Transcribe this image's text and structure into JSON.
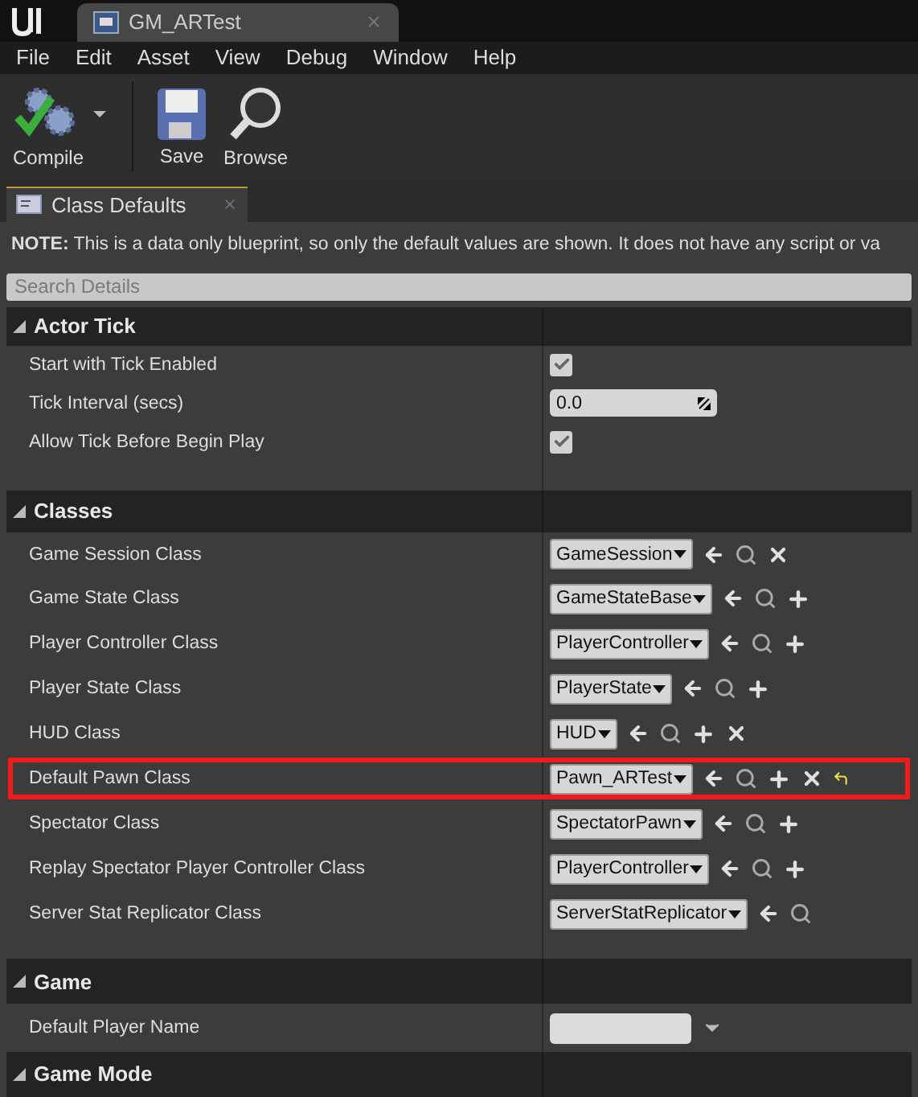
{
  "window": {
    "tab": "GM_ARTest"
  },
  "menu": [
    "File",
    "Edit",
    "Asset",
    "View",
    "Debug",
    "Window",
    "Help"
  ],
  "toolbar": [
    {
      "kind": "compile",
      "label": "Compile",
      "has_dropdown": true
    },
    {
      "kind": "save",
      "label": "Save",
      "has_dropdown": false
    },
    {
      "kind": "browse",
      "label": "Browse",
      "has_dropdown": false
    }
  ],
  "panel_tab": {
    "label": "Class Defaults"
  },
  "note": "**NOTE:** This is a data only blueprint, so only the default values are shown.  It does not have any script or va",
  "search": {
    "placeholder": "Search Details"
  },
  "sections": [
    {
      "title": "Actor Tick",
      "expanded": true,
      "rows": [
        {
          "label": "Start with Tick Enabled",
          "kind": "checkbox",
          "checked": true
        },
        {
          "label": "Tick Interval (secs)",
          "kind": "number",
          "value": "0.0"
        },
        {
          "label": "Allow Tick Before Begin Play",
          "kind": "checkbox",
          "checked": true
        }
      ]
    },
    {
      "title": "Classes",
      "expanded": true,
      "rows": [
        {
          "label": "Game Session Class",
          "kind": "class",
          "value": "GameSession",
          "buttons": [
            {
              "kind": "use"
            },
            {
              "kind": "browse"
            },
            {
              "kind": "clear"
            }
          ],
          "highlighted": false
        },
        {
          "label": "Game State Class",
          "kind": "class",
          "value": "GameStateBase",
          "buttons": [
            {
              "kind": "use"
            },
            {
              "kind": "browse"
            },
            {
              "kind": "add"
            }
          ],
          "highlighted": false
        },
        {
          "label": "Player Controller Class",
          "kind": "class",
          "value": "PlayerController",
          "buttons": [
            {
              "kind": "use"
            },
            {
              "kind": "browse"
            },
            {
              "kind": "add"
            }
          ],
          "highlighted": false
        },
        {
          "label": "Player State Class",
          "kind": "class",
          "value": "PlayerState",
          "buttons": [
            {
              "kind": "use"
            },
            {
              "kind": "browse"
            },
            {
              "kind": "add"
            }
          ],
          "highlighted": false
        },
        {
          "label": "HUD Class",
          "kind": "class",
          "value": "HUD",
          "buttons": [
            {
              "kind": "use"
            },
            {
              "kind": "browse"
            },
            {
              "kind": "add"
            },
            {
              "kind": "clear"
            }
          ],
          "highlighted": false
        },
        {
          "label": "Default Pawn Class",
          "kind": "class",
          "value": "Pawn_ARTest",
          "buttons": [
            {
              "kind": "use"
            },
            {
              "kind": "browse"
            },
            {
              "kind": "add"
            },
            {
              "kind": "clear"
            },
            {
              "kind": "reset"
            }
          ],
          "highlighted": true
        },
        {
          "label": "Spectator Class",
          "kind": "class",
          "value": "SpectatorPawn",
          "buttons": [
            {
              "kind": "use"
            },
            {
              "kind": "browse"
            },
            {
              "kind": "add"
            }
          ],
          "highlighted": false
        },
        {
          "label": "Replay Spectator Player Controller Class",
          "kind": "class",
          "value": "PlayerController",
          "buttons": [
            {
              "kind": "use"
            },
            {
              "kind": "browse"
            },
            {
              "kind": "add"
            }
          ],
          "highlighted": false
        },
        {
          "label": "Server Stat Replicator Class",
          "kind": "class",
          "value": "ServerStatReplicator",
          "buttons": [
            {
              "kind": "use"
            },
            {
              "kind": "browse"
            }
          ],
          "highlighted": false
        }
      ]
    },
    {
      "title": "Game",
      "expanded": true,
      "rows": [
        {
          "label": "Default Player Name",
          "kind": "combo"
        }
      ]
    },
    {
      "title": "Game Mode",
      "expanded": true
    }
  ]
}
